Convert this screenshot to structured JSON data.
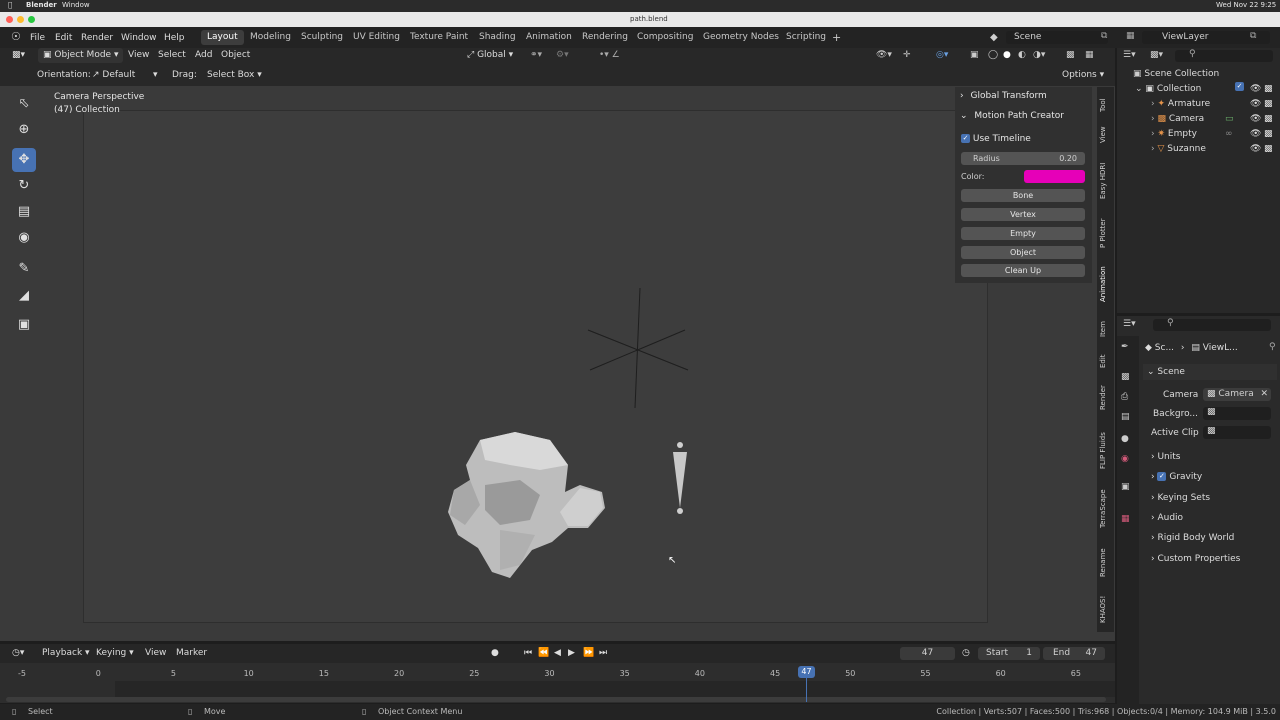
{
  "macbar": {
    "app": "Blender",
    "window": "Window",
    "clock": "Wed Nov 22  9:25"
  },
  "titlebar": {
    "title": "path.blend"
  },
  "menus": [
    "File",
    "Edit",
    "Render",
    "Window",
    "Help"
  ],
  "workspaces": [
    "Layout",
    "Modeling",
    "Sculpting",
    "UV Editing",
    "Texture Paint",
    "Shading",
    "Animation",
    "Rendering",
    "Compositing",
    "Geometry Nodes",
    "Scripting"
  ],
  "workspace_add": "+",
  "scene_field": "Scene",
  "viewlayer_field": "ViewLayer",
  "viewport_header": {
    "mode": "Object Mode",
    "menus": [
      "View",
      "Select",
      "Add",
      "Object"
    ],
    "transform_space": "Global",
    "orientation_label": "Orientation:",
    "orientation_value": "Default",
    "drag_label": "Drag:",
    "drag_value": "Select Box",
    "options": "Options"
  },
  "viewport": {
    "info_line1": "Camera Perspective",
    "info_line2": "(47) Collection"
  },
  "npanel": {
    "global_transform": "Global Transform",
    "motion_path_creator": "Motion Path Creator",
    "use_timeline": "Use Timeline",
    "radius_label": "Radius",
    "radius_value": "0.20",
    "color_label": "Color:",
    "color_value": "#e600b8",
    "buttons": [
      "Bone",
      "Vertex",
      "Empty",
      "Object",
      "Clean Up"
    ]
  },
  "vertical_tabs_top": [
    "Tool",
    "View",
    "Easy HDRI",
    "P Plotter",
    "Animation"
  ],
  "vertical_tabs_bottom": [
    "Item",
    "Edit",
    "Render",
    "FLIP Fluids",
    "TerraScape",
    "Rename",
    "KHAOS!"
  ],
  "outliner": {
    "scene_collection": "Scene Collection",
    "collection": "Collection",
    "items": [
      "Armature",
      "Camera",
      "Empty",
      "Suzanne"
    ]
  },
  "properties": {
    "breadcrumb_scene": "Sc...",
    "breadcrumb_viewlayer": "ViewL...",
    "scene_section": "Scene",
    "camera_label": "Camera",
    "camera_value": "Camera",
    "background_label": "Backgro...",
    "active_clip_label": "Active Clip",
    "sections": [
      "Units",
      "Gravity",
      "Keying Sets",
      "Audio",
      "Rigid Body World",
      "Custom Properties"
    ]
  },
  "timeline": {
    "menus": [
      "Playback",
      "Keying",
      "View",
      "Marker"
    ],
    "current_frame": "47",
    "start_label": "Start",
    "start_value": "1",
    "end_label": "End",
    "end_value": "47",
    "ticks": [
      "-5",
      "0",
      "5",
      "10",
      "15",
      "20",
      "25",
      "30",
      "35",
      "40",
      "45",
      "50",
      "55",
      "60",
      "65"
    ],
    "playhead": "47"
  },
  "status": {
    "select": "Select",
    "move": "Move",
    "context_menu": "Object Context Menu",
    "stats": "Collection | Verts:507 | Faces:500 | Tris:968 | Objects:0/4 | Memory: 104.9 MiB | 3.5.0"
  },
  "colors": {
    "accent": "#4772b3",
    "path_color": "#e600b8"
  }
}
